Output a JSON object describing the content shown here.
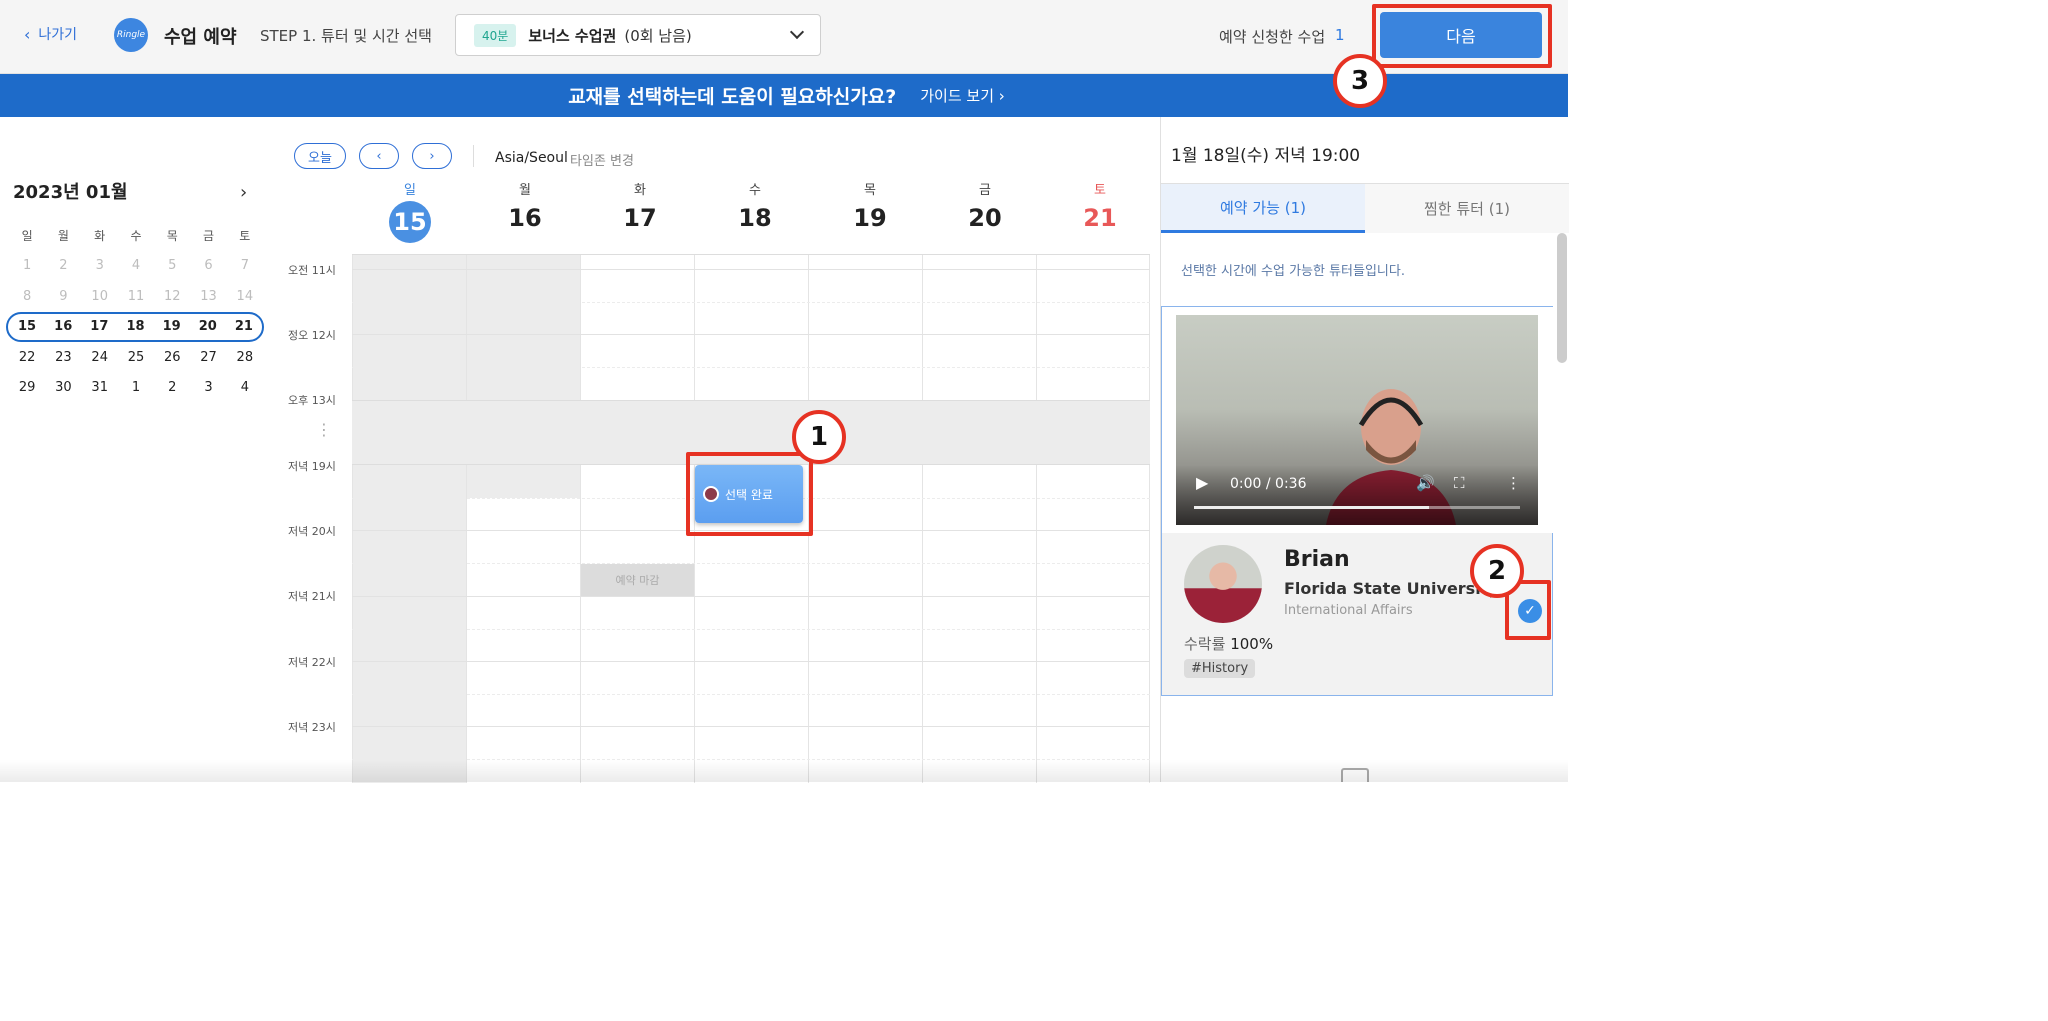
{
  "header": {
    "back_label": "나가기",
    "logo_text": "Ringle",
    "title": "수업 예약",
    "step": "STEP 1. 튜터 및 시간 선택",
    "ticket": {
      "badge": "40분",
      "name": "보너스 수업권",
      "count": "(0회 남음)"
    },
    "requested_label": "예약 신청한 수업",
    "requested_count": "1",
    "next_button": "다음"
  },
  "banner": {
    "question": "교재를 선택하는데 도움이 필요하신가요?",
    "guide": "가이드 보기"
  },
  "mini_calendar": {
    "month": "2023년 01월",
    "weekdays": [
      "일",
      "월",
      "화",
      "수",
      "목",
      "금",
      "토"
    ],
    "weeks": [
      [
        "1",
        "2",
        "3",
        "4",
        "5",
        "6",
        "7"
      ],
      [
        "8",
        "9",
        "10",
        "11",
        "12",
        "13",
        "14"
      ],
      [
        "15",
        "16",
        "17",
        "18",
        "19",
        "20",
        "21"
      ],
      [
        "22",
        "23",
        "24",
        "25",
        "26",
        "27",
        "28"
      ],
      [
        "29",
        "30",
        "31",
        "1",
        "2",
        "3",
        "4"
      ]
    ]
  },
  "week_view": {
    "today_button": "오늘",
    "timezone": "Asia/Seoul",
    "timezone_change": "타임존 변경",
    "days": [
      {
        "dow": "일",
        "num": "15"
      },
      {
        "dow": "월",
        "num": "16"
      },
      {
        "dow": "화",
        "num": "17"
      },
      {
        "dow": "수",
        "num": "18"
      },
      {
        "dow": "목",
        "num": "19"
      },
      {
        "dow": "금",
        "num": "20"
      },
      {
        "dow": "토",
        "num": "21"
      }
    ],
    "time_labels": [
      "오전 11시",
      "정오 12시",
      "오후 13시",
      "저녁 19시",
      "저녁 20시",
      "저녁 21시",
      "저녁 22시",
      "저녁 23시"
    ],
    "closed_label": "예약 마감",
    "selected_label": "선택 완료"
  },
  "right_panel": {
    "date_title": "1월 18일(수) 저녁 19:00",
    "tab_available": "예약 가능 (1)",
    "tab_favorite": "찜한 튜터 (1)",
    "note": "선택한 시간에 수업 가능한 튜터들입니다.",
    "video_time": "0:00 / 0:36",
    "video_progress": 0.72,
    "tutor": {
      "name": "Brian",
      "university": "Florida State University",
      "major": "International Affairs",
      "accept_label": "수락률",
      "accept_rate": "100%",
      "tag": "#History"
    }
  },
  "annotations": {
    "one": "1",
    "two": "2",
    "three": "3"
  },
  "colors": {
    "primary": "#3a84dd",
    "banner": "#1e6bc9",
    "highlight": "#e63223",
    "saturday": "#e85858"
  }
}
